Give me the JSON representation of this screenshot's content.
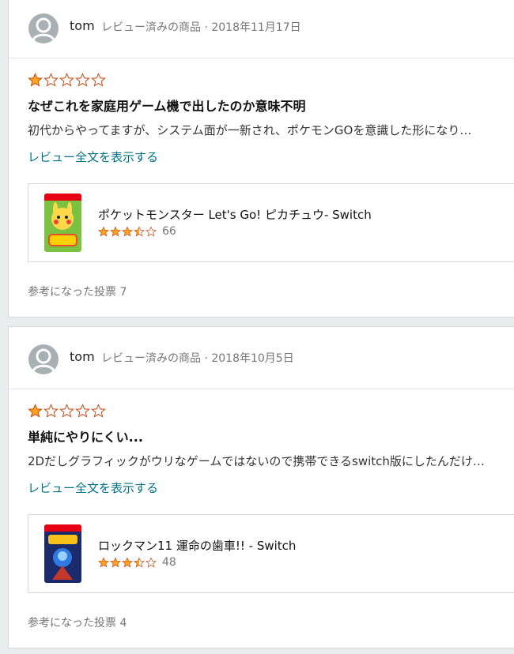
{
  "reviews": [
    {
      "username": "tom",
      "meta": "レビュー済みの商品 · 2018年11月17日",
      "rating": 1,
      "title": "なぜこれを家庭用ゲーム機で出したのか意味不明",
      "snippet": "初代からやってますが、システム面が一新され、ポケモンGOを意識した形になり…",
      "read_more": "レビュー全文を表示する",
      "product": {
        "name": "ポケットモンスター Let's Go! ピカチュウ- Switch",
        "rating": 3.5,
        "rating_count": "66"
      },
      "helpful": "参考になった投票 7"
    },
    {
      "username": "tom",
      "meta": "レビュー済みの商品 · 2018年10月5日",
      "rating": 1,
      "title": "単純にやりにくい...",
      "snippet": "2Dだしグラフィックがウリなゲームではないので携帯できるswitch版にしたんだけ…",
      "read_more": "レビュー全文を表示する",
      "product": {
        "name": "ロックマン11 運命の歯車!! - Switch",
        "rating": 3.5,
        "rating_count": "48"
      },
      "helpful": "参考になった投票 4"
    }
  ],
  "colors": {
    "star": "#ffa41c",
    "link": "#007185",
    "background": "#eaeded"
  }
}
